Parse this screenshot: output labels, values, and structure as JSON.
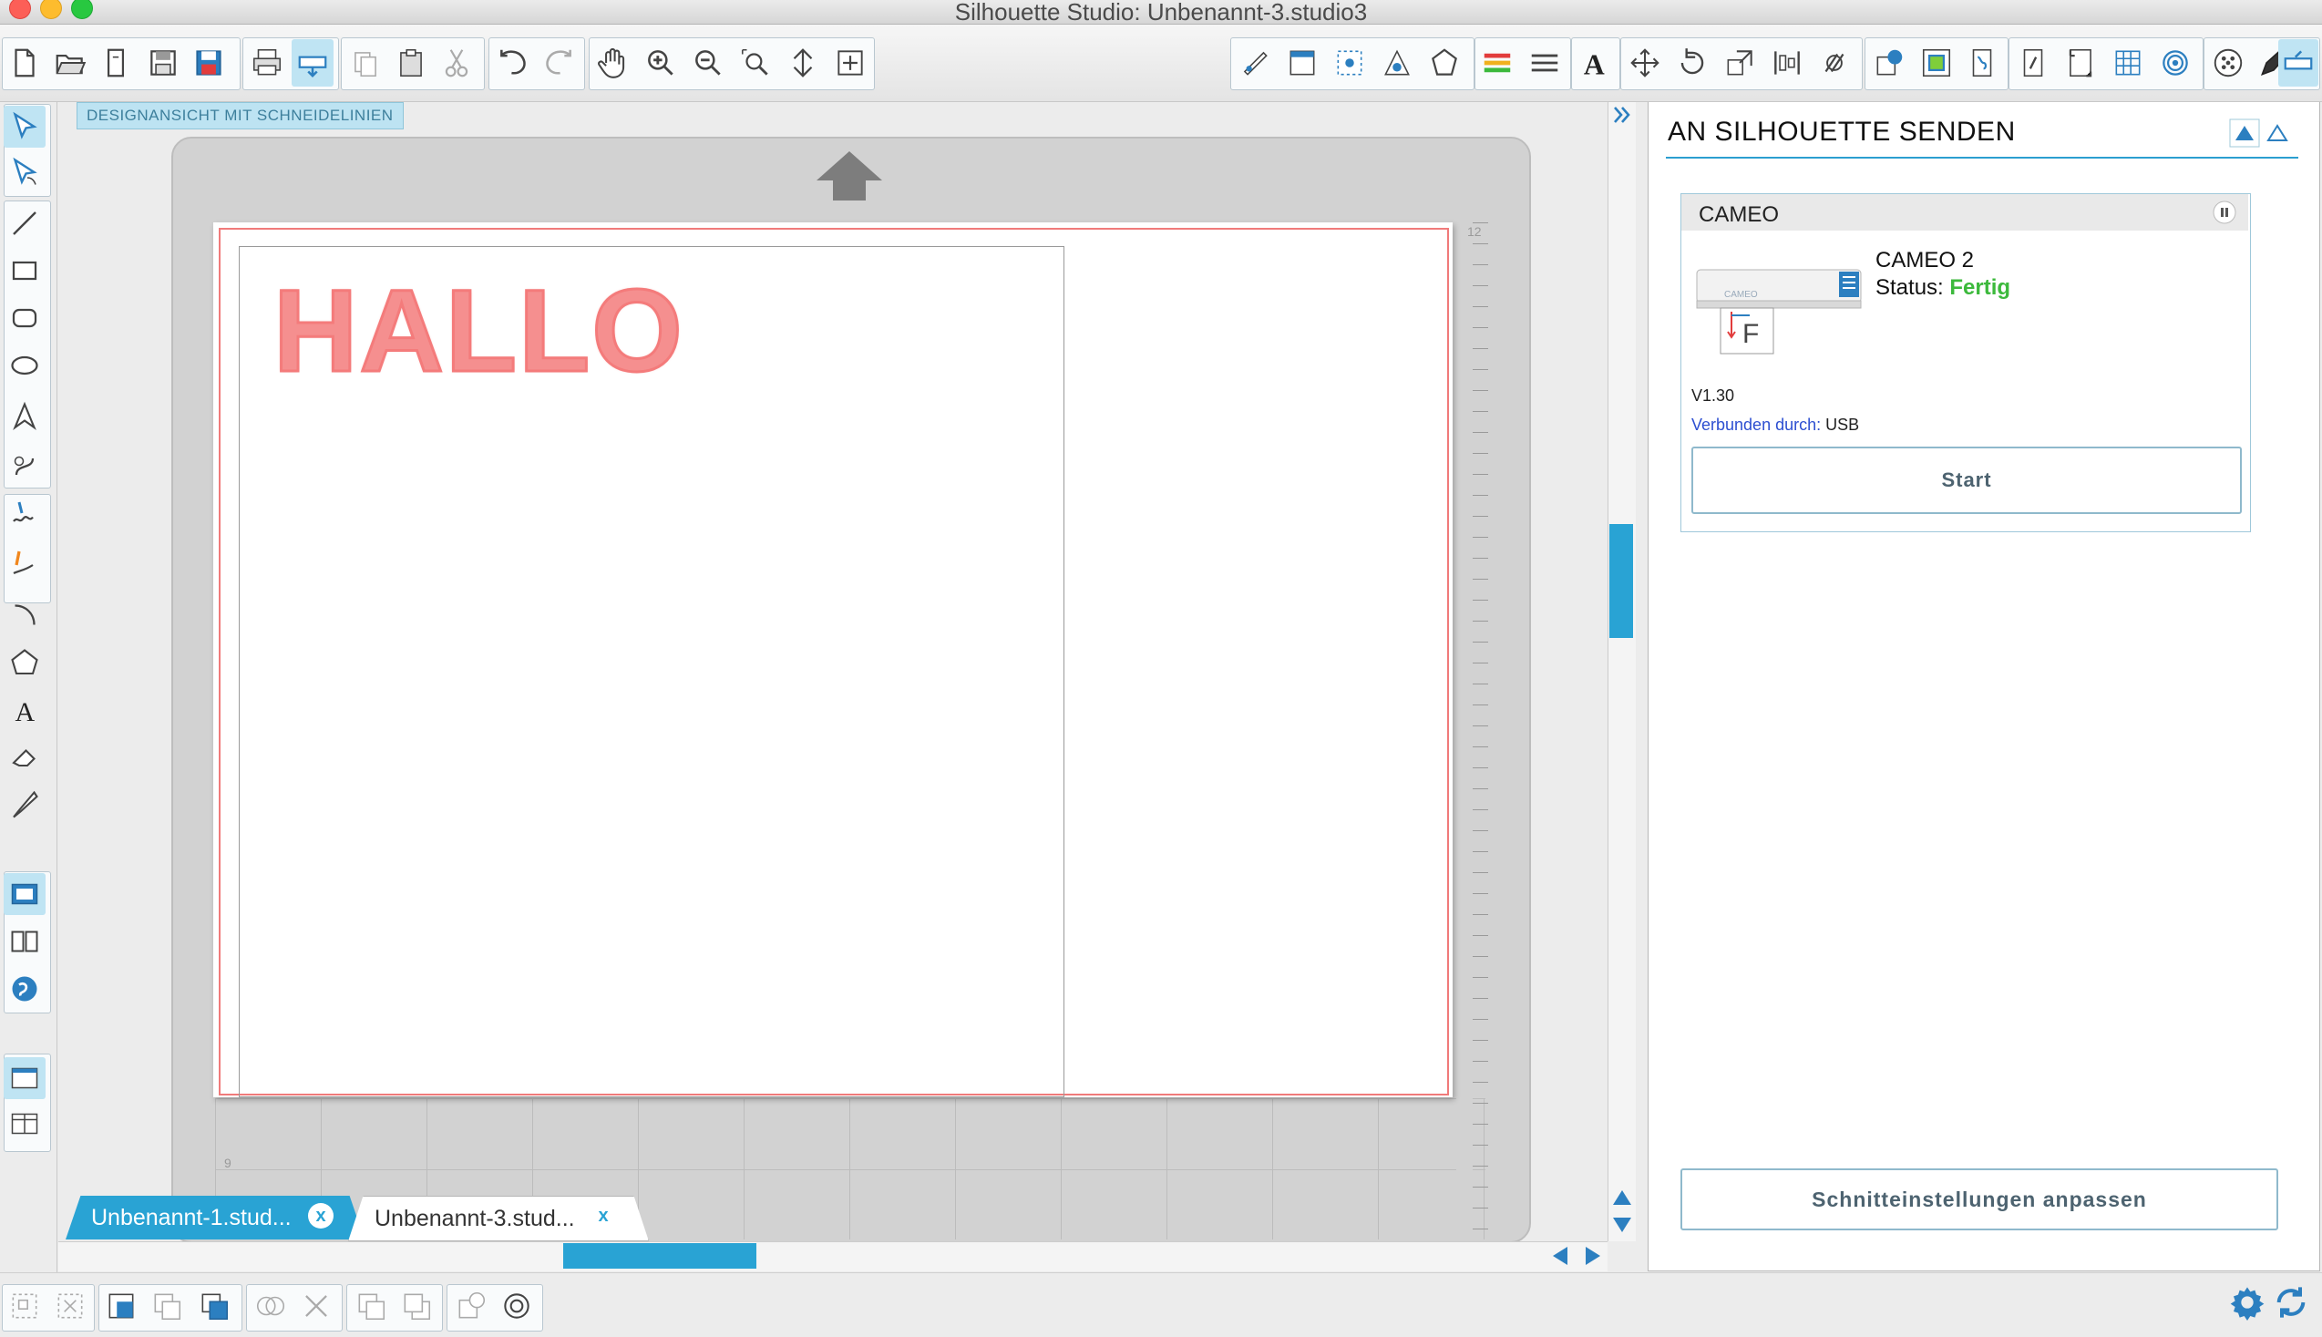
{
  "window": {
    "title": "Silhouette Studio: Unbenannt-3.studio3"
  },
  "canvas": {
    "view_badge": "DESIGNANSICHT MIT SCHNEIDELINIEN",
    "design_text": "HALLO",
    "ruler_labels": [
      "12",
      "9"
    ]
  },
  "tabs": [
    {
      "label": "Unbenannt-1.stud...",
      "close": "x"
    },
    {
      "label": "Unbenannt-3.stud...",
      "close": "x"
    }
  ],
  "send_panel": {
    "title": "AN SILHOUETTE SENDEN",
    "device_section": "CAMEO",
    "device_name": "CAMEO 2",
    "status_label": "Status:",
    "status_value": "Fertig",
    "firmware": "V1.30",
    "connected_label": "Verbunden durch:",
    "connected_value": "USB",
    "start_button": "Start",
    "adjust_button": "Schnitteinstellungen anpassen",
    "machine_letter": "F",
    "machine_brand": "CAMEO"
  },
  "colors": {
    "accent": "#29a3d4",
    "status_ok": "#3cb93c",
    "cut_line": "#f07a7a",
    "text_design": "#f58f8f",
    "link_blue": "#2d4fd1"
  }
}
